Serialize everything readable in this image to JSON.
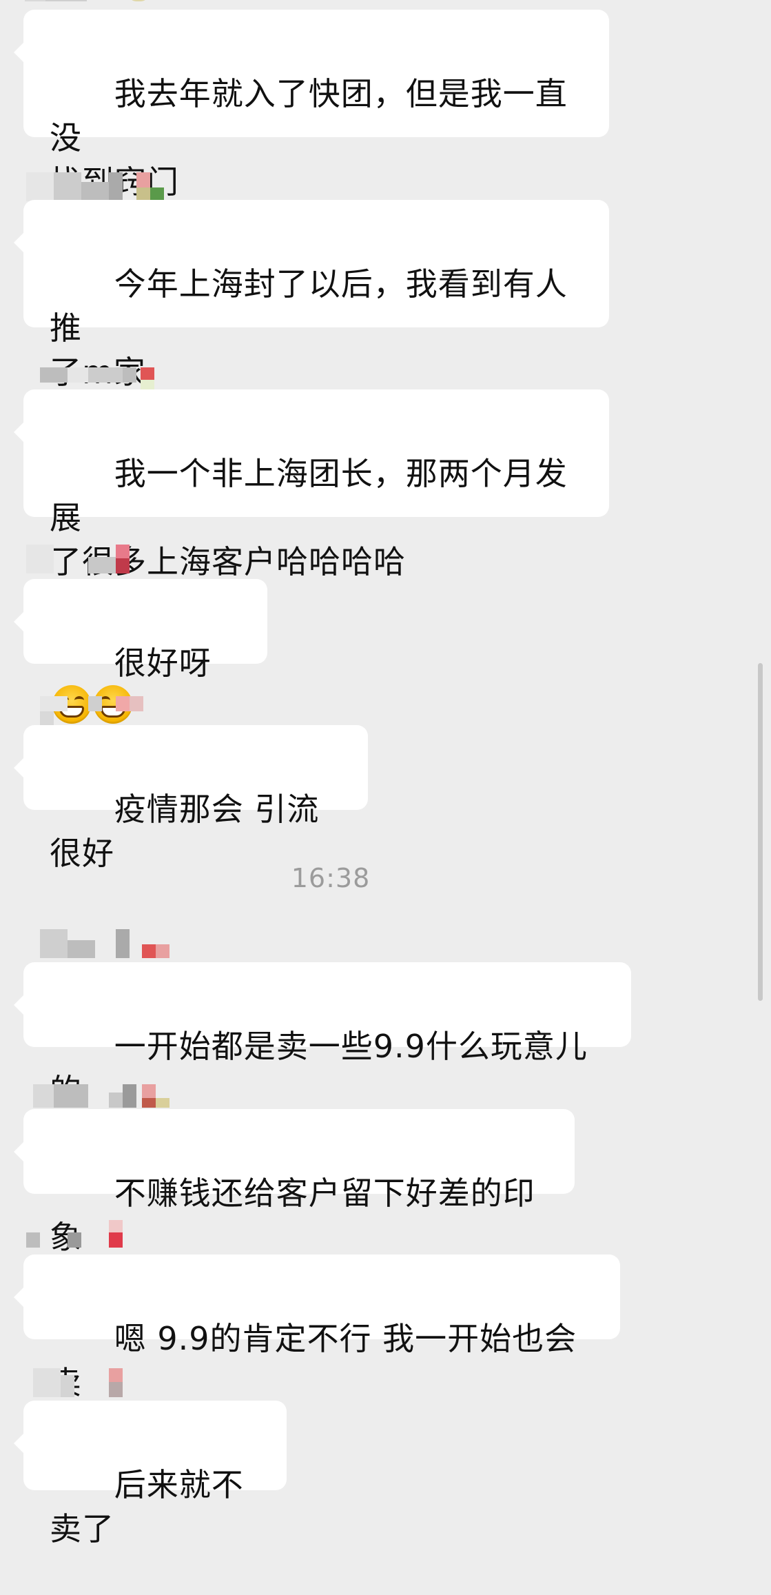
{
  "messages": [
    {
      "text": "我去年就入了快团，但是我一直没\n找到窍门"
    },
    {
      "text": "今年上海封了以后，我看到有人推\n了m家"
    },
    {
      "text": "我一个非上海团长，那两个月发展\n了很多上海客户哈哈哈哈"
    },
    {
      "text": "很好呀"
    },
    {
      "text": "疫情那会 引流很好"
    },
    {
      "text": "一开始都是卖一些9.9什么玩意儿的"
    },
    {
      "text": "不赚钱还给客户留下好差的印象"
    },
    {
      "text": "嗯 9.9的肯定不行 我一开始也会卖"
    },
    {
      "text": "后来就不卖了"
    }
  ],
  "timestamp": "16:38",
  "colors": {
    "background": "#ededed",
    "bubble": "#ffffff",
    "timestamp": "#9b9b9b"
  },
  "icons": {
    "grin_emoji": "grinning-face-emoji"
  }
}
